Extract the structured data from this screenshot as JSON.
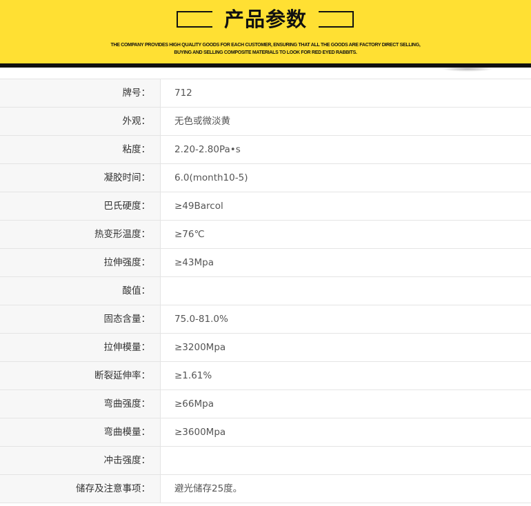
{
  "banner": {
    "title": "产品参数",
    "subtitle_line1": "THE COMPANY PROVIDES HIGH QUALITY GOODS FOR EACH CUSTOMER, ENSURING THAT ALL THE GOODS ARE FACTORY DIRECT SELLING,",
    "subtitle_line2": "BUYING AND SELLING COMPOSITE MATERIALS TO LOOK FOR RED EYED RABBITS.",
    "background_color": "#ffe033",
    "border_color": "#111111"
  },
  "params": [
    {
      "label": "牌号：",
      "value": "712"
    },
    {
      "label": "外观：",
      "value": "无色或微淡黄"
    },
    {
      "label": "粘度：",
      "value": "2.20-2.80Pa•s"
    },
    {
      "label": "凝胶时间：",
      "value": "6.0(month10-5)"
    },
    {
      "label": "巴氏硬度：",
      "value": "≥49Barcol"
    },
    {
      "label": "热变形温度：",
      "value": "≥76℃"
    },
    {
      "label": "拉伸强度：",
      "value": "≥43Mpa"
    },
    {
      "label": "酸值：",
      "value": ""
    },
    {
      "label": "固态含量：",
      "value": "75.0-81.0%"
    },
    {
      "label": "拉伸模量：",
      "value": "≥3200Mpa"
    },
    {
      "label": "断裂延伸率：",
      "value": "≥1.61%"
    },
    {
      "label": "弯曲强度：",
      "value": "≥66Mpa"
    },
    {
      "label": "弯曲模量：",
      "value": "≥3600Mpa"
    },
    {
      "label": "冲击强度：",
      "value": ""
    },
    {
      "label": "储存及注意事项：",
      "value": "避光储存25度。"
    }
  ]
}
